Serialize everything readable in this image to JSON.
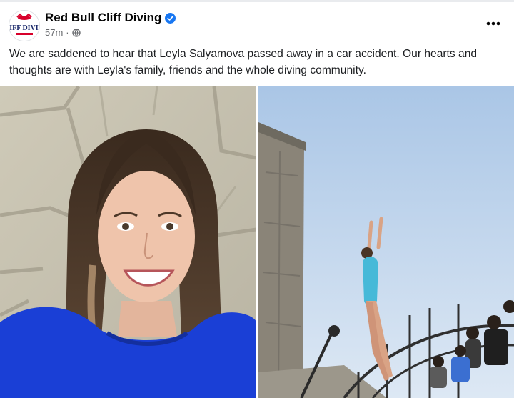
{
  "post": {
    "page_name": "Red Bull Cliff Diving",
    "avatar_text_top": "Red Bull",
    "avatar_text_bottom": "CLIFF DIVING",
    "timestamp": "57m",
    "separator": "·",
    "audience_icon": "globe-icon",
    "verified_icon": "verified-badge-icon",
    "more_icon": "more-options-icon",
    "text": "We are saddened to hear that Leyla Salyamova passed away in a car accident. Our hearts and thoughts are with Leyla's family, friends and the whole diving community."
  },
  "photos": [
    {
      "subject": "portrait-photo"
    },
    {
      "subject": "diving-photo"
    }
  ],
  "colors": {
    "verified": "#1877f2",
    "secondary_text": "#65676b",
    "brand_red": "#d7002b",
    "sky": "#c6d9ef",
    "shirt": "#1a3fd6"
  }
}
